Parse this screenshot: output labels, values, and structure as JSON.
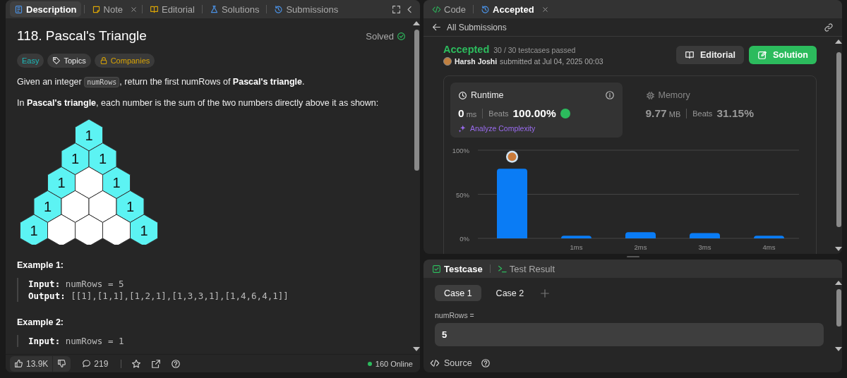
{
  "problem_panel": {
    "tabs": [
      {
        "label": "Description",
        "selected": true,
        "closable": false
      },
      {
        "label": "Note",
        "selected": false,
        "closable": true
      },
      {
        "label": "Editorial",
        "selected": false,
        "closable": false
      },
      {
        "label": "Solutions",
        "selected": false,
        "closable": false
      },
      {
        "label": "Submissions",
        "selected": false,
        "closable": false
      }
    ],
    "title": "118. Pascal's Triangle",
    "status": "Solved",
    "tags": [
      {
        "label": "Easy",
        "kind": "difficulty"
      },
      {
        "label": "Topics",
        "kind": "topics"
      },
      {
        "label": "Companies",
        "kind": "companies"
      }
    ],
    "statement": [
      {
        "before": "Given an integer ",
        "code": "numRows",
        "after": ", return the first numRows of **Pascal's triangle**."
      },
      {
        "before": "In **Pascal's triangle**, each number is the sum of the two numbers directly above it as shown:"
      }
    ],
    "triangle": [
      [
        {
          "label": "1",
          "filled": true
        }
      ],
      [
        {
          "label": "1",
          "filled": true
        },
        {
          "label": "1",
          "filled": true
        }
      ],
      [
        {
          "label": "1",
          "filled": true
        },
        {
          "filled": false
        },
        {
          "label": "1",
          "filled": true
        }
      ],
      [
        {
          "label": "1",
          "filled": true
        },
        {
          "filled": false
        },
        {
          "filled": false
        },
        {
          "label": "1",
          "filled": true
        }
      ],
      [
        {
          "label": "1",
          "filled": true
        },
        {
          "filled": false
        },
        {
          "filled": false
        },
        {
          "filled": false
        },
        {
          "label": "1",
          "filled": true
        }
      ]
    ],
    "examples": [
      {
        "title": "Example 1:",
        "lines": [
          {
            "label": "Input:",
            "value": "numRows = 5"
          },
          {
            "label": "Output:",
            "value": "[[1],[1,1],[1,2,1],[1,3,3,1],[1,4,6,4,1]]"
          }
        ]
      },
      {
        "title": "Example 2:",
        "lines": [
          {
            "label": "Input:",
            "value": "numRows = 1"
          }
        ]
      }
    ],
    "footer": {
      "likes": "13.9K",
      "comments": "219",
      "online": "160 Online"
    }
  },
  "submission_panel": {
    "tabs": [
      {
        "label": "Code",
        "selected": false,
        "closable": false
      },
      {
        "label": "Accepted",
        "selected": true,
        "closable": true
      }
    ],
    "back_link": "All Submissions",
    "result": {
      "status": "Accepted",
      "testcases": "30 / 30 testcases passed",
      "author": "Harsh Joshi",
      "submitted": "submitted at Jul 04, 2025 00:03"
    },
    "buttons": [
      {
        "label": "Editorial",
        "kind": "secondary"
      },
      {
        "label": "Solution",
        "kind": "primary"
      }
    ],
    "metrics": [
      {
        "title": "Runtime",
        "value": "0",
        "unit": "ms",
        "beats_label": "Beats",
        "beats": "100.00%",
        "selected": true,
        "action": "Analyze Complexity"
      },
      {
        "title": "Memory",
        "value": "9.77",
        "unit": "MB",
        "beats_label": "Beats",
        "beats": "31.15%",
        "selected": false
      }
    ],
    "chart_data": {
      "type": "bar",
      "categories": [
        null,
        "1ms",
        "2ms",
        "3ms",
        "4ms"
      ],
      "series": [
        {
          "color": "#0a7cf5",
          "values": [
            79,
            3,
            7,
            6,
            3
          ]
        }
      ],
      "ylim": [
        0,
        100
      ],
      "yticks": [
        {
          "value": 0,
          "label": "0%"
        },
        {
          "value": 50,
          "label": "50%"
        },
        {
          "value": 100,
          "label": "100%"
        }
      ]
    }
  },
  "console_panel": {
    "tabs": [
      {
        "label": "Testcase",
        "selected": true
      },
      {
        "label": "Test Result",
        "selected": false
      }
    ],
    "cases": [
      {
        "label": "Case 1",
        "selected": true
      },
      {
        "label": "Case 2",
        "selected": false
      }
    ],
    "param": "numRows =",
    "value": "5",
    "source": "Source"
  }
}
